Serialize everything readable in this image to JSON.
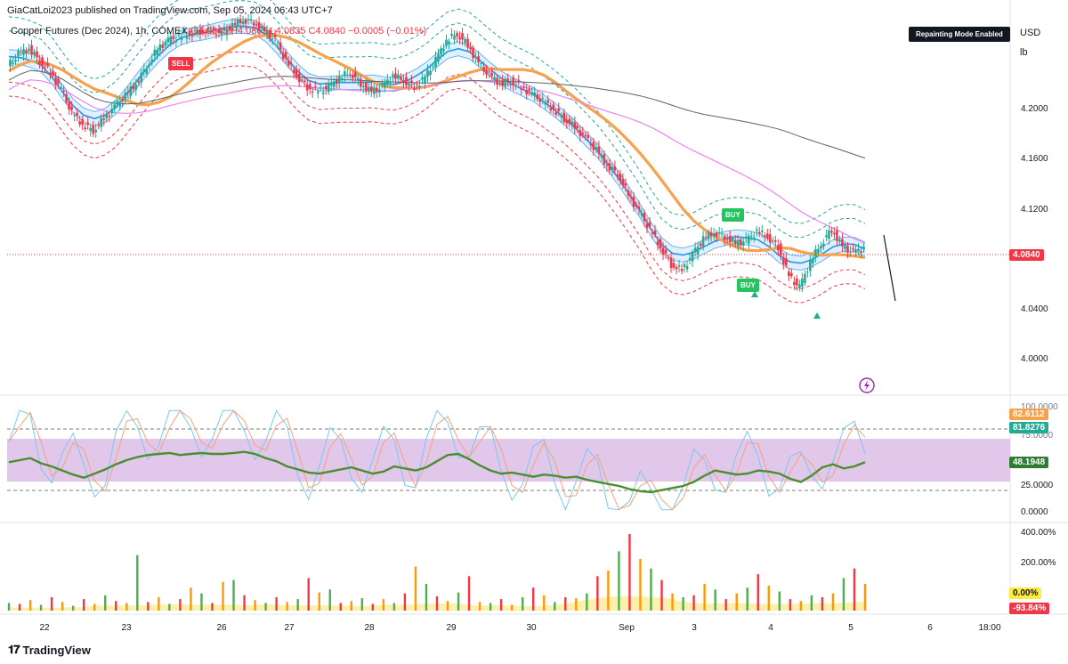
{
  "header": {
    "publisher": "GiaCatLoi2023 published on TradingView.com, Sep 05, 2024 06:43 UTC+7",
    "symbol": "Copper Futures (Dec 2024), 1h, COMEX",
    "ohlc_text": "O4.0845 H4.0865 L4.0835 C4.0840 −0.0005 (−0.01%)",
    "repaint_badge": "Repainting Mode Enabled",
    "currency": "USD",
    "unit": "lb"
  },
  "price_axis": {
    "ticks": [
      "4.2000",
      "4.1600",
      "4.1200",
      "4.0800",
      "4.0400",
      "4.0000"
    ],
    "last_price_label": "4.0840",
    "last_price": 4.084
  },
  "oscillator_axis": {
    "ticks": [
      "100.0000",
      "75.0000",
      "25.0000",
      "0.0000"
    ],
    "badges": [
      "82.6112",
      "81.8276",
      "48.1948"
    ]
  },
  "volume_axis": {
    "ticks": [
      "400.00%",
      "200.00%"
    ],
    "badges": [
      "0.00%",
      "-93.84%"
    ]
  },
  "time_axis": {
    "ticks": [
      "22",
      "23",
      "26",
      "27",
      "28",
      "29",
      "30",
      "Sep",
      "3",
      "4",
      "5",
      "6",
      "18:00"
    ]
  },
  "signals": {
    "sell": "SELL",
    "buy1": "BUY",
    "buy2": "BUY"
  },
  "footer": {
    "brand": "TradingView"
  },
  "colors": {
    "up": "#22ab94",
    "down": "#f23645",
    "ema_orange": "#f7a14a",
    "ma_pink": "#ee82ee",
    "ma_grey": "#5d606b",
    "band_blue": "#2196f3",
    "rsi_green": "#4a8f2f",
    "stoch_k": "#7bc8ee",
    "stoch_d": "#f7a17a",
    "rsi_band": "#e1c7ea",
    "vol_fill": "#fce98a",
    "last_price_badge": "#f23645",
    "osc_badge_orange": "#f7a14a",
    "osc_badge_green": "#22ab94",
    "osc_badge_dark": "#2e7d32",
    "vol_badge_yellow": "#ffeb3b",
    "vol_badge_red": "#f23645"
  },
  "chart_data": {
    "type": "candlestick",
    "title": "Copper Futures (Dec 2024), 1h, COMEX",
    "y_range_price": [
      3.97,
      4.28
    ],
    "close_path": [
      4.24,
      4.25,
      4.255,
      4.245,
      4.235,
      4.22,
      4.2,
      4.19,
      4.185,
      4.195,
      4.205,
      4.215,
      4.225,
      4.24,
      4.255,
      4.262,
      4.265,
      4.268,
      4.27,
      4.27,
      4.268,
      4.275,
      4.28,
      4.278,
      4.27,
      4.262,
      4.245,
      4.232,
      4.222,
      4.218,
      4.222,
      4.23,
      4.235,
      4.225,
      4.218,
      4.222,
      4.232,
      4.228,
      4.222,
      4.23,
      4.245,
      4.262,
      4.268,
      4.258,
      4.242,
      4.232,
      4.225,
      4.228,
      4.222,
      4.216,
      4.21,
      4.203,
      4.195,
      4.188,
      4.178,
      4.168,
      4.155,
      4.148,
      4.13,
      4.115,
      4.1,
      4.085,
      4.07,
      4.065,
      4.078,
      4.092,
      4.098,
      4.094,
      4.088,
      4.09,
      4.098,
      4.094,
      4.085,
      4.06,
      4.05,
      4.072,
      4.088,
      4.1,
      4.085,
      4.08,
      4.084
    ],
    "rsi": [
      48,
      50,
      52,
      47,
      44,
      40,
      36,
      33,
      37,
      41,
      46,
      50,
      53,
      55,
      56,
      57,
      55,
      56,
      57,
      56,
      56,
      57,
      58,
      56,
      52,
      49,
      44,
      41,
      38,
      37,
      39,
      41,
      43,
      40,
      37,
      39,
      44,
      42,
      40,
      43,
      49,
      55,
      56,
      51,
      45,
      40,
      37,
      38,
      36,
      34,
      36,
      35,
      33,
      34,
      31,
      29,
      27,
      25,
      22,
      20,
      19,
      21,
      23,
      25,
      29,
      35,
      40,
      38,
      36,
      37,
      40,
      39,
      37,
      32,
      29,
      35,
      43,
      46,
      42,
      44,
      48
    ],
    "volume_pct": [
      40,
      35,
      55,
      30,
      70,
      45,
      25,
      60,
      35,
      80,
      50,
      40,
      290,
      45,
      70,
      35,
      60,
      120,
      90,
      40,
      150,
      160,
      80,
      55,
      40,
      70,
      45,
      60,
      170,
      95,
      110,
      40,
      50,
      65,
      35,
      60,
      40,
      90,
      230,
      140,
      75,
      50,
      95,
      180,
      45,
      40,
      60,
      30,
      70,
      120,
      80,
      45,
      70,
      65,
      90,
      180,
      210,
      310,
      400,
      270,
      220,
      160,
      90,
      70,
      80,
      140,
      110,
      60,
      90,
      120,
      190,
      130,
      100,
      60,
      50,
      80,
      70,
      90,
      170,
      220,
      140
    ],
    "volume_pct_range": [
      -100,
      400
    ],
    "osc_range": [
      0,
      100
    ]
  }
}
